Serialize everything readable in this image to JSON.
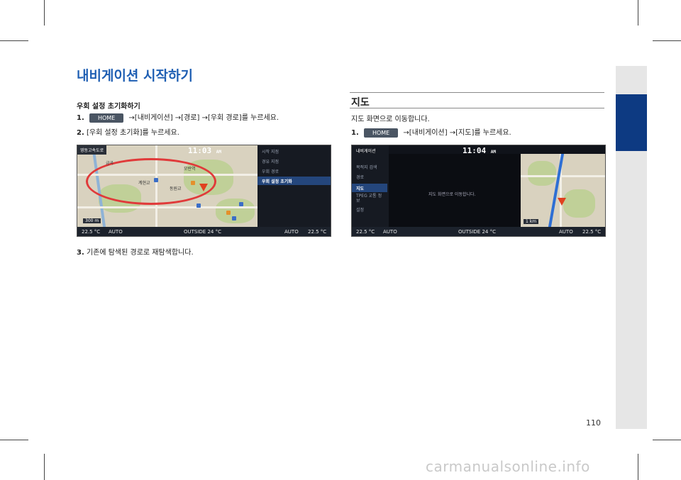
{
  "title": "내비게이션 시작하기",
  "left": {
    "subtitle": "우회 설정 초기화하기",
    "step1": {
      "num": "1.",
      "button": "HOME",
      "text": "→[내비게이션] →[경로] →[우회 경로]를 누르세요."
    },
    "step2": {
      "num": "2.",
      "text": "[우회 설정 초기화]를 누르세요."
    },
    "step3": {
      "num": "3.",
      "text": "기존에 탐색된 경로로 재탐색합니다."
    },
    "screen": {
      "location": "영동고속도로",
      "time": "11:03",
      "ampm": "AM",
      "scale": "300 m",
      "menu": [
        "시작 지점",
        "경유 지점",
        "우회 경로",
        "우회 설정 초기화"
      ],
      "status": {
        "temp_left": "22.5 °C",
        "auto_left": "AUTO",
        "outside": "OUTSIDE  24 °C",
        "auto_right": "AUTO",
        "temp_right": "22.5 °C"
      },
      "map_labels": [
        "계현교",
        "동원교",
        "모란역",
        "금곡"
      ]
    }
  },
  "right": {
    "section_title": "지도",
    "desc": "지도 화면으로 이동합니다.",
    "step1": {
      "num": "1.",
      "button": "HOME",
      "text": "→[내비게이션] →[지도]를 누르세요."
    },
    "screen": {
      "header": "내비게이션",
      "time": "11:04",
      "ampm": "AM",
      "menu": [
        "목적지 검색",
        "경로",
        "지도",
        "TPEG 교통 정보",
        "설정"
      ],
      "message": "지도 화면으로 이동합니다.",
      "scale": "1 km",
      "status": {
        "temp_left": "22.5 °C",
        "auto_left": "AUTO",
        "outside": "OUTSIDE  24 °C",
        "auto_right": "AUTO",
        "temp_right": "22.5 °C"
      }
    }
  },
  "page_number": "110",
  "watermark": "carmanualsonline.info"
}
